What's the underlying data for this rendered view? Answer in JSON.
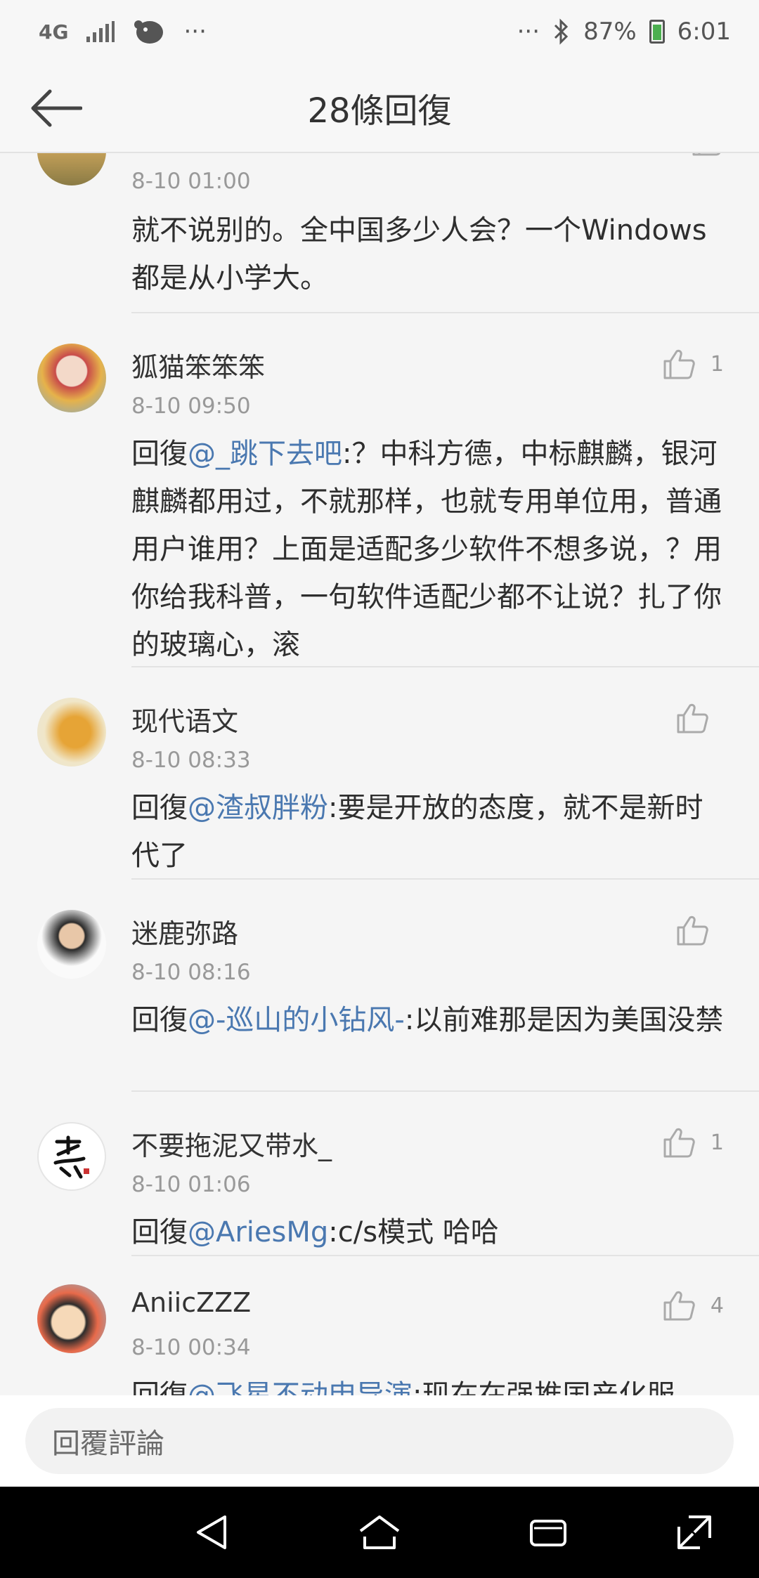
{
  "status_bar": {
    "network": "4G",
    "more": "···",
    "battery": "87%",
    "time": "6:01"
  },
  "header": {
    "title": "28條回復"
  },
  "comments": [
    {
      "time": "8-10 01:00",
      "text": "就不说别的。全中国多少人会？一个Windows都是从小学大。"
    },
    {
      "username": "狐猫笨笨笨",
      "time": "8-10 09:50",
      "likes": "1",
      "reply_prefix": "回復",
      "mention": "@_跳下去吧",
      "text": ":？中科方德，中标麒麟，银河麒麟都用过，不就那样，也就专用单位用，普通用户谁用？上面是适配多少软件不想多说，？用你给我科普，一句软件适配少都不让说？扎了你的玻璃心，滚"
    },
    {
      "username": "现代语文",
      "time": "8-10 08:33",
      "likes": "",
      "reply_prefix": "回復",
      "mention": "@渣叔胖粉",
      "text": ":要是开放的态度，就不是新时代了"
    },
    {
      "username": "迷鹿弥路",
      "time": "8-10 08:16",
      "likes": "",
      "reply_prefix": "回復",
      "mention": "@-巡山的小钻风-",
      "text": ":以前难那是因为美国没禁"
    },
    {
      "username": "不要拖泥又带水_",
      "time": "8-10 01:06",
      "likes": "1",
      "reply_prefix": "回復",
      "mention": "@AriesMg",
      "text": ":c/s模式 哈哈"
    },
    {
      "username": "AniicZZZ",
      "time": "8-10 00:34",
      "likes": "4",
      "reply_prefix": "回復",
      "mention": "@飞星不动申导演",
      "text": ":现在在强推国产化服"
    }
  ],
  "reply_box": {
    "placeholder": "回覆評論"
  },
  "colors": {
    "mention": "#4a78b0",
    "background": "#f5f5f5",
    "nav": "#000000"
  }
}
